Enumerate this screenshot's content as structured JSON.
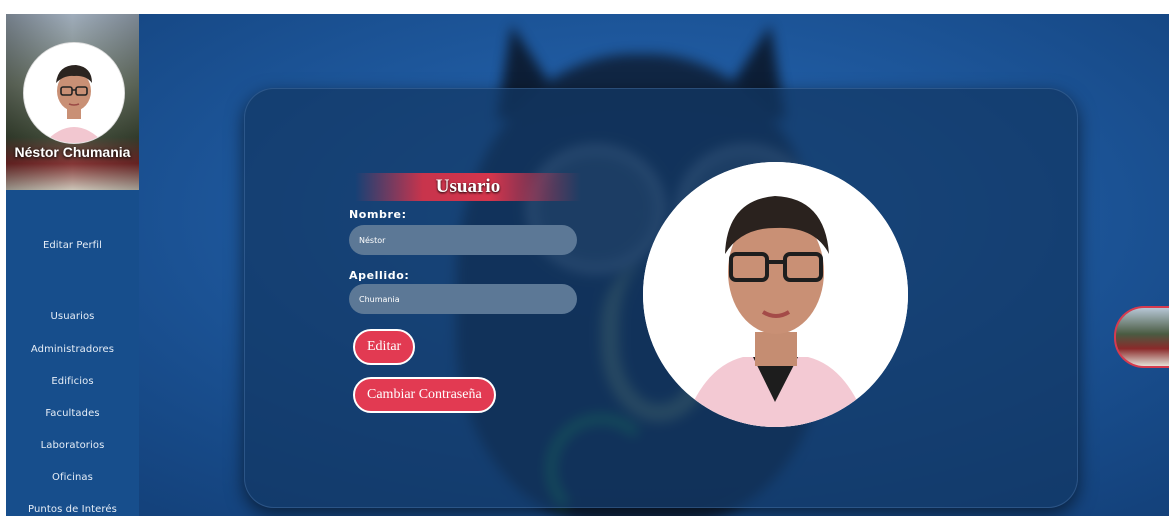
{
  "sidebar": {
    "profile_name": "Néstor Chumania",
    "items": [
      {
        "label": "Editar Perfil"
      },
      {
        "label": "Usuarios"
      },
      {
        "label": "Administradores"
      },
      {
        "label": "Edificios"
      },
      {
        "label": "Facultades"
      },
      {
        "label": "Laboratorios"
      },
      {
        "label": "Oficinas"
      },
      {
        "label": "Puntos de Interés"
      }
    ]
  },
  "form": {
    "title": "Usuario",
    "nombre_label": "Nombre:",
    "nombre_value": "Néstor",
    "apellido_label": "Apellido:",
    "apellido_value": "Chumania",
    "edit_button": "Editar",
    "change_password_button": "Cambiar Contraseña"
  },
  "colors": {
    "accent": "#e23a52",
    "sidebar": "#174e8c",
    "background": "#1f5aa0"
  }
}
